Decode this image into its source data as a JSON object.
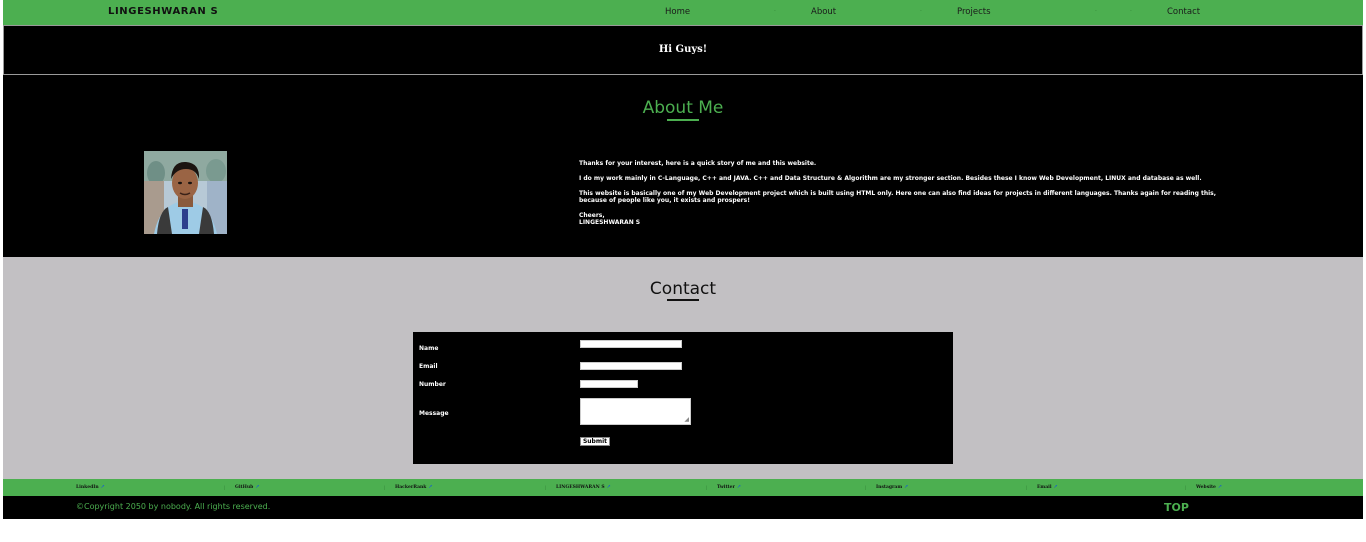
{
  "nav": {
    "brand": "LINGESHWARAN S",
    "links": [
      "Home",
      "About",
      "Projects",
      "Contact"
    ],
    "separator": "·"
  },
  "hero": {
    "text": "Hi Guys!"
  },
  "about": {
    "title": "About Me",
    "paragraphs": [
      "Thanks for your interest, here is a quick story of me and this website.",
      "I do my work mainly in C-Language, C++ and JAVA. C++ and Data Structure & Algorithm are my stronger section. Besides these I know Web Development, LINUX and database as well.",
      "This website is basically one of my Web Development project which is built using HTML only. Here one can also find ideas for projects in different languages. Thanks again for reading this, because of people like you, it exists and prospers!"
    ],
    "signoff": "Cheers,",
    "signature": "LINGESHWARAN S"
  },
  "contact": {
    "title": "Contact",
    "fields": {
      "name_label": "Name",
      "name_value": "",
      "email_label": "Email",
      "email_value": "",
      "number_label": "Number",
      "number_value": "",
      "message_label": "Message",
      "message_value": ""
    },
    "submit_label": "Submit"
  },
  "social": {
    "links": [
      "LinkedIn",
      "GitHub",
      "HackerRank",
      "LINGESHWARAN S",
      "Twitter",
      "Instagram",
      "Email",
      "Website"
    ],
    "ext_icon": "↗"
  },
  "footer": {
    "copyright": "©Copyright 2050 by nobody. All rights reserved.",
    "top_label": "TOP"
  },
  "colors": {
    "accent": "#4caf50",
    "contact_bg": "#c2c0c3",
    "dark": "#000000"
  }
}
